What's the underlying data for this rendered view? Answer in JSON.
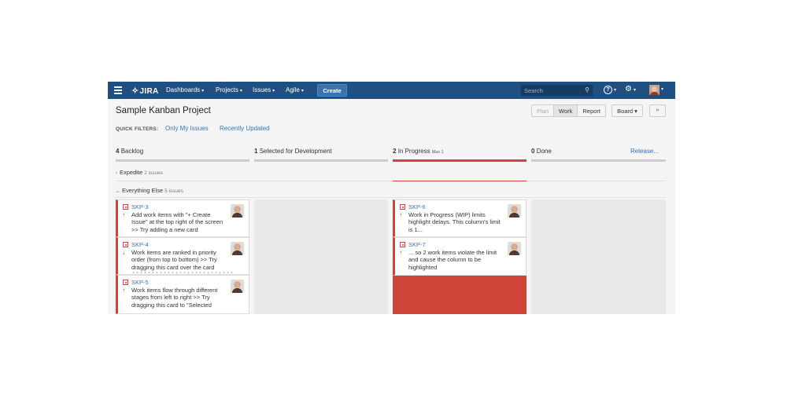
{
  "nav": {
    "logo": "JIRA",
    "logo_mark": "✧",
    "items": [
      {
        "label": "Dashboards",
        "caret": "▾"
      },
      {
        "label": "Projects",
        "caret": "▾"
      },
      {
        "label": "Issues",
        "caret": "▾"
      },
      {
        "label": "Agile",
        "caret": "▾"
      }
    ],
    "create_label": "Create",
    "search_placeholder": "Search",
    "search_icon": "⚲",
    "help_icon": "?",
    "settings_icon": "⚙",
    "dropdown_caret": "▾"
  },
  "header": {
    "project_title": "Sample Kanban Project",
    "modes": [
      "Plan",
      "Work",
      "Report"
    ],
    "active_mode": "Work",
    "board_label": "Board ▾",
    "collapse_label": "»"
  },
  "quick_filters": {
    "label": "QUICK FILTERS:",
    "items": [
      "Only My Issues",
      "Recently Updated"
    ]
  },
  "columns": [
    {
      "count": "4",
      "name": "Backlog",
      "max": ""
    },
    {
      "count": "1",
      "name": "Selected for Development",
      "max": ""
    },
    {
      "count": "2",
      "name": "In Progress",
      "max": "Max 1"
    },
    {
      "count": "0",
      "name": "Done",
      "max": ""
    }
  ],
  "release_label": "Release...",
  "swimlanes": [
    {
      "name": "Expedite",
      "count": "2 issues",
      "arrow": "›"
    },
    {
      "name": "Everything Else",
      "count": "5 issues",
      "arrow": "⌄"
    }
  ],
  "cards": [
    {
      "key": "SKP-3",
      "priority": "↑",
      "summary": "Add work items with \"+ Create Issue\" at the top right of the screen >> Try adding a new card"
    },
    {
      "key": "SKP-4",
      "priority": "↓",
      "summary": "Work items are ranked in priority order (from top to bottom) >> Try dragging this card over the card"
    },
    {
      "key": "SKP-5",
      "priority": "↑",
      "summary": "Work items flow through different stages from left to right >> Try dragging this card to \"Selected"
    },
    {
      "key": "SKP-6",
      "priority": "↑",
      "summary": "Work in Progress (WIP) limits highlight delays. This column's limit is 1..."
    },
    {
      "key": "SKP-7",
      "priority": "↑",
      "summary": "... so 2 work items violate the limit and cause the column to be highlighted"
    }
  ],
  "colors": {
    "nav_bg": "#205081",
    "create_bg": "#3b73af",
    "link": "#3572b0",
    "wip_alert": "#d04437",
    "priority_up": "#d04437",
    "priority_down": "#14892c"
  }
}
